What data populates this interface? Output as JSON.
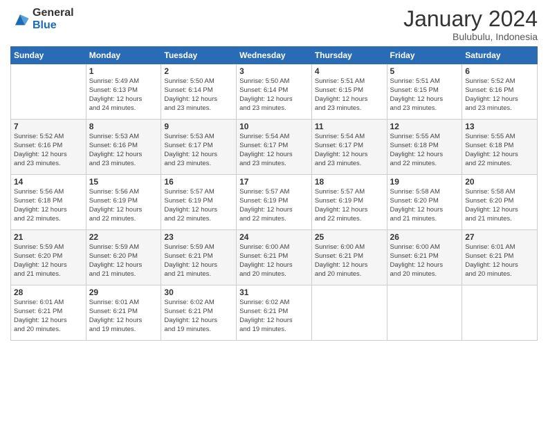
{
  "logo": {
    "general": "General",
    "blue": "Blue"
  },
  "title": "January 2024",
  "location": "Bulubulu, Indonesia",
  "days_header": [
    "Sunday",
    "Monday",
    "Tuesday",
    "Wednesday",
    "Thursday",
    "Friday",
    "Saturday"
  ],
  "weeks": [
    [
      {
        "day": "",
        "info": ""
      },
      {
        "day": "1",
        "info": "Sunrise: 5:49 AM\nSunset: 6:13 PM\nDaylight: 12 hours\nand 24 minutes."
      },
      {
        "day": "2",
        "info": "Sunrise: 5:50 AM\nSunset: 6:14 PM\nDaylight: 12 hours\nand 23 minutes."
      },
      {
        "day": "3",
        "info": "Sunrise: 5:50 AM\nSunset: 6:14 PM\nDaylight: 12 hours\nand 23 minutes."
      },
      {
        "day": "4",
        "info": "Sunrise: 5:51 AM\nSunset: 6:15 PM\nDaylight: 12 hours\nand 23 minutes."
      },
      {
        "day": "5",
        "info": "Sunrise: 5:51 AM\nSunset: 6:15 PM\nDaylight: 12 hours\nand 23 minutes."
      },
      {
        "day": "6",
        "info": "Sunrise: 5:52 AM\nSunset: 6:16 PM\nDaylight: 12 hours\nand 23 minutes."
      }
    ],
    [
      {
        "day": "7",
        "info": "Sunrise: 5:52 AM\nSunset: 6:16 PM\nDaylight: 12 hours\nand 23 minutes."
      },
      {
        "day": "8",
        "info": "Sunrise: 5:53 AM\nSunset: 6:16 PM\nDaylight: 12 hours\nand 23 minutes."
      },
      {
        "day": "9",
        "info": "Sunrise: 5:53 AM\nSunset: 6:17 PM\nDaylight: 12 hours\nand 23 minutes."
      },
      {
        "day": "10",
        "info": "Sunrise: 5:54 AM\nSunset: 6:17 PM\nDaylight: 12 hours\nand 23 minutes."
      },
      {
        "day": "11",
        "info": "Sunrise: 5:54 AM\nSunset: 6:17 PM\nDaylight: 12 hours\nand 23 minutes."
      },
      {
        "day": "12",
        "info": "Sunrise: 5:55 AM\nSunset: 6:18 PM\nDaylight: 12 hours\nand 22 minutes."
      },
      {
        "day": "13",
        "info": "Sunrise: 5:55 AM\nSunset: 6:18 PM\nDaylight: 12 hours\nand 22 minutes."
      }
    ],
    [
      {
        "day": "14",
        "info": "Sunrise: 5:56 AM\nSunset: 6:18 PM\nDaylight: 12 hours\nand 22 minutes."
      },
      {
        "day": "15",
        "info": "Sunrise: 5:56 AM\nSunset: 6:19 PM\nDaylight: 12 hours\nand 22 minutes."
      },
      {
        "day": "16",
        "info": "Sunrise: 5:57 AM\nSunset: 6:19 PM\nDaylight: 12 hours\nand 22 minutes."
      },
      {
        "day": "17",
        "info": "Sunrise: 5:57 AM\nSunset: 6:19 PM\nDaylight: 12 hours\nand 22 minutes."
      },
      {
        "day": "18",
        "info": "Sunrise: 5:57 AM\nSunset: 6:19 PM\nDaylight: 12 hours\nand 22 minutes."
      },
      {
        "day": "19",
        "info": "Sunrise: 5:58 AM\nSunset: 6:20 PM\nDaylight: 12 hours\nand 21 minutes."
      },
      {
        "day": "20",
        "info": "Sunrise: 5:58 AM\nSunset: 6:20 PM\nDaylight: 12 hours\nand 21 minutes."
      }
    ],
    [
      {
        "day": "21",
        "info": "Sunrise: 5:59 AM\nSunset: 6:20 PM\nDaylight: 12 hours\nand 21 minutes."
      },
      {
        "day": "22",
        "info": "Sunrise: 5:59 AM\nSunset: 6:20 PM\nDaylight: 12 hours\nand 21 minutes."
      },
      {
        "day": "23",
        "info": "Sunrise: 5:59 AM\nSunset: 6:21 PM\nDaylight: 12 hours\nand 21 minutes."
      },
      {
        "day": "24",
        "info": "Sunrise: 6:00 AM\nSunset: 6:21 PM\nDaylight: 12 hours\nand 20 minutes."
      },
      {
        "day": "25",
        "info": "Sunrise: 6:00 AM\nSunset: 6:21 PM\nDaylight: 12 hours\nand 20 minutes."
      },
      {
        "day": "26",
        "info": "Sunrise: 6:00 AM\nSunset: 6:21 PM\nDaylight: 12 hours\nand 20 minutes."
      },
      {
        "day": "27",
        "info": "Sunrise: 6:01 AM\nSunset: 6:21 PM\nDaylight: 12 hours\nand 20 minutes."
      }
    ],
    [
      {
        "day": "28",
        "info": "Sunrise: 6:01 AM\nSunset: 6:21 PM\nDaylight: 12 hours\nand 20 minutes."
      },
      {
        "day": "29",
        "info": "Sunrise: 6:01 AM\nSunset: 6:21 PM\nDaylight: 12 hours\nand 19 minutes."
      },
      {
        "day": "30",
        "info": "Sunrise: 6:02 AM\nSunset: 6:21 PM\nDaylight: 12 hours\nand 19 minutes."
      },
      {
        "day": "31",
        "info": "Sunrise: 6:02 AM\nSunset: 6:21 PM\nDaylight: 12 hours\nand 19 minutes."
      },
      {
        "day": "",
        "info": ""
      },
      {
        "day": "",
        "info": ""
      },
      {
        "day": "",
        "info": ""
      }
    ]
  ]
}
